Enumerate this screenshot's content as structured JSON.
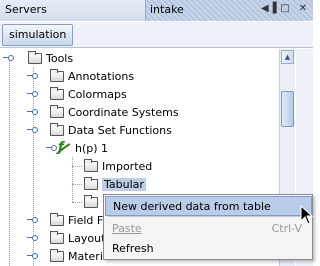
{
  "titlebar": {
    "tabs": [
      {
        "label": "Servers"
      },
      {
        "label": "intake"
      }
    ],
    "icons": [
      "minimize-restore-icon",
      "maximize-icon",
      "close-icon"
    ]
  },
  "toolbar": {
    "sim_tab": "simulation"
  },
  "tree": {
    "root": "Tools",
    "items": [
      {
        "label": "Annotations"
      },
      {
        "label": "Colormaps"
      },
      {
        "label": "Coordinate Systems"
      },
      {
        "label": "Data Set Functions"
      },
      {
        "label": "h(p) 1"
      },
      {
        "label": "Imported"
      },
      {
        "label": "Tabular"
      },
      {
        "label": "Field Fu"
      },
      {
        "label": "Layouts"
      },
      {
        "label": "Material Databases"
      }
    ]
  },
  "context_menu": {
    "items": [
      {
        "label": "New derived data from table",
        "shortcut": "",
        "enabled": true
      },
      {
        "label": "Paste",
        "shortcut": "Ctrl-V",
        "enabled": false
      },
      {
        "label": "Refresh",
        "shortcut": "",
        "enabled": true
      }
    ]
  },
  "colors": {
    "accent": "#b9cce9",
    "selection": "#bccde6",
    "function_icon": "#2e7d1e"
  }
}
